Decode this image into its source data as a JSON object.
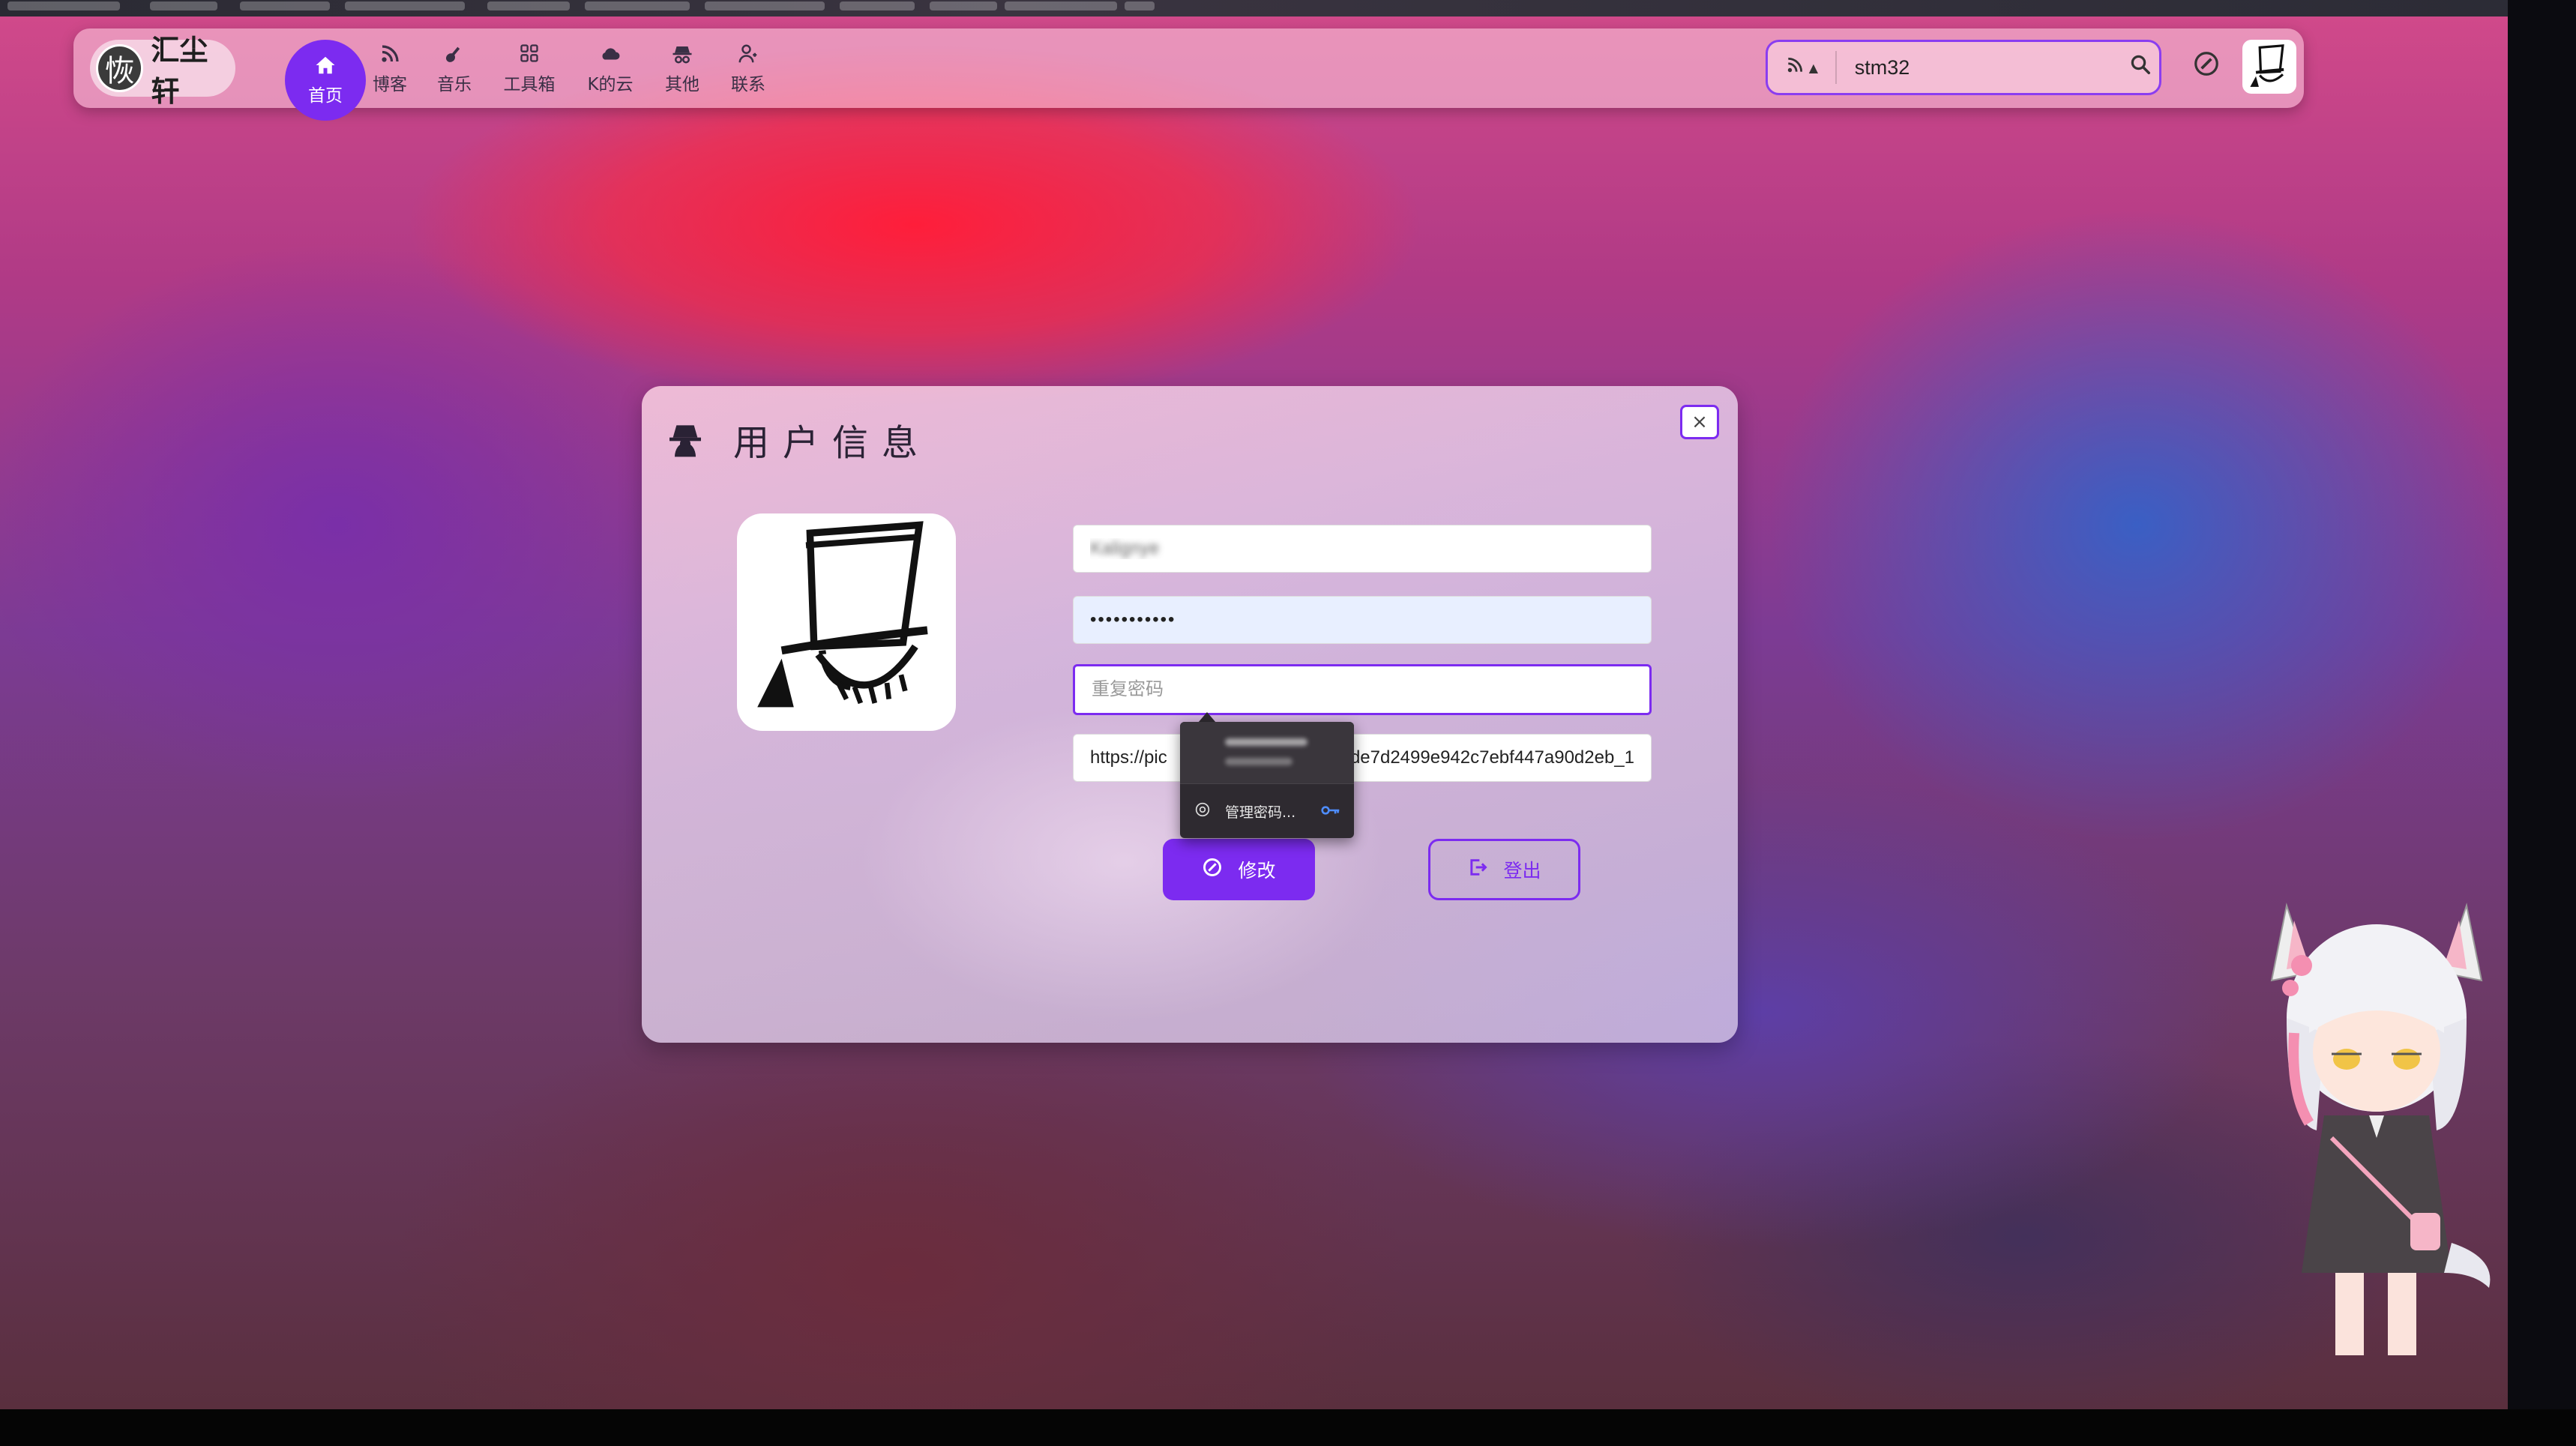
{
  "nav": {
    "logo_text": "汇尘轩",
    "logo_badge": "恢",
    "items": [
      {
        "label": "首页",
        "icon": "home-icon",
        "active": true
      },
      {
        "label": "博客",
        "icon": "feed-icon"
      },
      {
        "label": "音乐",
        "icon": "guitar-icon"
      },
      {
        "label": "工具箱",
        "icon": "grid-icon"
      },
      {
        "label": "K的云",
        "icon": "cloud-icon"
      },
      {
        "label": "其他",
        "icon": "spy-icon"
      },
      {
        "label": "联系",
        "icon": "contact-icon"
      }
    ],
    "search_value": "stm32",
    "search_engine_icon": "feed-icon"
  },
  "modal": {
    "title": "用户信息",
    "username_value": "Kalignye",
    "password_value": "•••••••••••",
    "repeat_password_placeholder": "重复密码",
    "avatar_url_value": "https://pic1de7d2499e942c7ebf447a90d2eb_1",
    "avatar_url_left": "https://pic",
    "avatar_url_right": "1de7d2499e942c7ebf447a90d2eb_1",
    "edit_label": "修改",
    "logout_label": "登出",
    "close_label": "×"
  },
  "password_popup": {
    "manage_label": "管理密码..."
  },
  "colors": {
    "accent": "#7c2bf0",
    "popup_bg": "#2e2a30",
    "key_icon": "#4e8dff"
  }
}
